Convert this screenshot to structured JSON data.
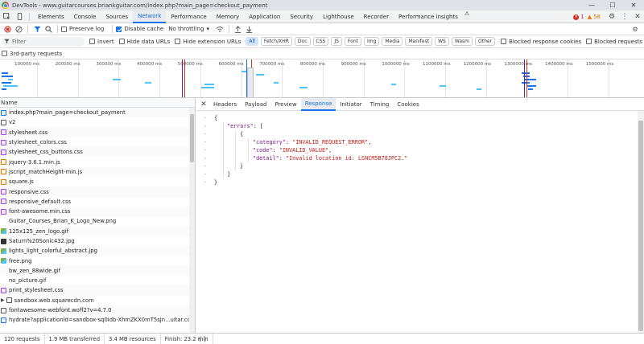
{
  "window": {
    "title": "DevTools - www.guitarcourses.briankguitar.com/index.php?main_page=checkout_payment",
    "minimize": "—",
    "maximize": "☐",
    "close": "✕"
  },
  "tabs": [
    "Elements",
    "Console",
    "Sources",
    "Network",
    "Performance",
    "Memory",
    "Application",
    "Security",
    "Lighthouse",
    "Recorder",
    "Performance insights"
  ],
  "active_tab": "Network",
  "issues": {
    "errors": "1",
    "warnings": "58"
  },
  "toolbar": {
    "preserve_log": "Preserve log",
    "disable_cache": "Disable cache",
    "throttling": "No throttling"
  },
  "filter": {
    "placeholder": "Filter",
    "invert": "Invert",
    "hide_data_urls": "Hide data URLs",
    "hide_extension_urls": "Hide extension URLs",
    "types": [
      "All",
      "Fetch/XHR",
      "Doc",
      "CSS",
      "JS",
      "Font",
      "Img",
      "Media",
      "Manifest",
      "WS",
      "Wasm",
      "Other"
    ],
    "blocked_response_cookies": "Blocked response cookies",
    "blocked_requests": "Blocked requests",
    "third_party": "3rd-party requests"
  },
  "timeline": {
    "ticks": [
      "100000 ms",
      "200000 ms",
      "300000 ms",
      "400000 ms",
      "500000 ms",
      "600000 ms",
      "700000 ms",
      "800000 ms",
      "900000 ms",
      "1000000 ms",
      "1100000 ms",
      "1200000 ms",
      "1300000 ms",
      "1400000 ms",
      "1500000 ms"
    ]
  },
  "requests": {
    "header": "Name",
    "items": [
      {
        "name": "index.php?main_page=checkout_payment",
        "type": "doc"
      },
      {
        "name": "v2",
        "type": "blank-box"
      },
      {
        "name": "stylesheet.css",
        "type": "css"
      },
      {
        "name": "stylesheet_colors.css",
        "type": "css"
      },
      {
        "name": "stylesheet_css_buttons.css",
        "type": "css"
      },
      {
        "name": "jquery-3.6.1.min.js",
        "type": "js"
      },
      {
        "name": "jscript_matchHeight-min.js",
        "type": "js"
      },
      {
        "name": "square.js",
        "type": "js"
      },
      {
        "name": "responsive.css",
        "type": "css"
      },
      {
        "name": "responsive_default.css",
        "type": "css"
      },
      {
        "name": "font-awesome.min.css",
        "type": "css"
      },
      {
        "name": "Guitar_Courses_Brian_K_Logo_New.png",
        "type": "blank"
      },
      {
        "name": "125x125_zen_logo.gif",
        "type": "img"
      },
      {
        "name": "Saturn%20Sonic432.jpg",
        "type": "dark"
      },
      {
        "name": "lights_light_colorful_abstract.jpg",
        "type": "img"
      },
      {
        "name": "free.png",
        "type": "img"
      },
      {
        "name": "bw_zen_88wide.gif",
        "type": "blank"
      },
      {
        "name": "no_picture.gif",
        "type": "blank"
      },
      {
        "name": "print_stylesheet.css",
        "type": "css"
      },
      {
        "name": "sandbox.web.squarecdn.com",
        "type": "folder"
      },
      {
        "name": "fontawesome-webfont.woff2?v=4.7.0",
        "type": "font"
      },
      {
        "name": "hydrate?applicationId=sandbox-sq0idb-XhmZKX0mT5sJn...uitar.com...",
        "type": "doc"
      }
    ]
  },
  "detail_tabs": [
    "Headers",
    "Payload",
    "Preview",
    "Response",
    "Initiator",
    "Timing",
    "Cookies"
  ],
  "active_detail_tab": "Response",
  "response": {
    "line1": "{",
    "errors_key": "\"errors\"",
    "errors_open": ": [",
    "obj_open": "{",
    "category_key": "\"category\"",
    "category_val": "\"INVALID_REQUEST_ERROR\"",
    "code_key": "\"code\"",
    "code_val": "\"INVALID_VALUE\"",
    "detail_key": "\"detail\"",
    "detail_val": "\"Invalid location id: LSNCM5B78JPC2.\"",
    "obj_close": "}",
    "arr_close": "]",
    "last": "}"
  },
  "status": {
    "requests": "120 requests",
    "transferred": "1.9 MB transferred",
    "resources": "3.4 MB resources",
    "finish": "Finish: 23.2 min"
  },
  "colors": {
    "accent": "#1a73e8",
    "error": "#d93025",
    "warning": "#e37400"
  }
}
